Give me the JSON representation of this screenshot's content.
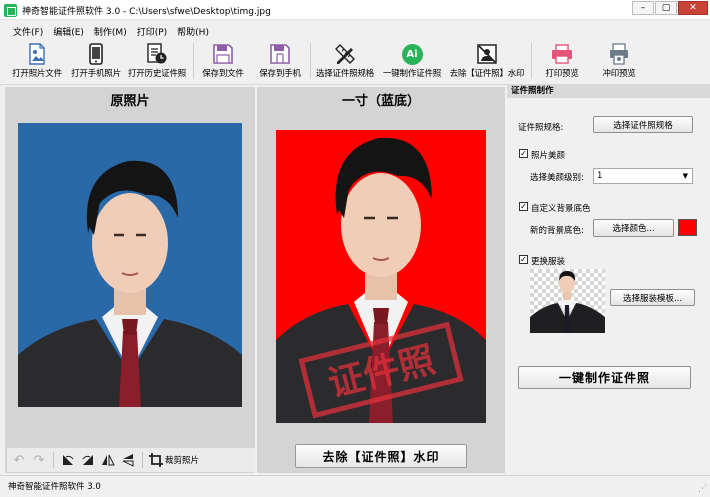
{
  "window": {
    "title": "神奇智能证件照软件 3.0 - C:\\Users\\sfwe\\Desktop\\timg.jpg",
    "minimize_glyph": "–",
    "maximize_glyph": "▢",
    "close_glyph": "✕"
  },
  "menu": [
    "文件(F)",
    "编辑(E)",
    "制作(M)",
    "打印(P)",
    "帮助(H)"
  ],
  "toolbar": {
    "open_photo": "打开照片文件",
    "open_phone": "打开手机照片",
    "open_history": "打开历史证件照",
    "save_file": "保存到文件",
    "save_phone": "保存到手机",
    "choose_spec": "选择证件照规格",
    "one_click": "一键制作证件照",
    "remove_watermark": "去除【证件照】水印",
    "print_preview": "打印预览",
    "wash_preview": "冲印预览",
    "ai_badge": "Ai"
  },
  "original": {
    "title": "原照片",
    "bg_color": "#2a69a8",
    "tools": {
      "undo_glyph": "↶",
      "redo_glyph": "↷",
      "crop_label": "裁剪照片"
    }
  },
  "result": {
    "title": "一寸（蓝底）",
    "bg_color": "#ff0000",
    "watermark_text": "证件照",
    "remove_watermark_button": "去除【证件照】水印"
  },
  "settings": {
    "header": "证件照制作",
    "spec_label": "证件照规格:",
    "spec_button": "选择证件照规格",
    "beauty_checkbox": "照片美颜",
    "beauty_checked": true,
    "beauty_level_label": "选择美颜级别:",
    "beauty_level_value": "1",
    "custom_bg_checkbox": "自定义背景底色",
    "custom_bg_checked": true,
    "new_bg_label": "新的背景底色:",
    "choose_color_button": "选择颜色...",
    "selected_color": "#ff0000",
    "change_clothes_checkbox": "更换服装",
    "change_clothes_checked": true,
    "choose_clothes_button": "选择服装模板...",
    "make_button": "一键制作证件照"
  },
  "status": {
    "text": "神奇智能证件照软件 3.0"
  },
  "colors": {
    "accent_red": "#e0303a",
    "accent_green": "#2bb35b",
    "accent_purple": "#8e5fa8",
    "accent_pink": "#e4557a"
  }
}
